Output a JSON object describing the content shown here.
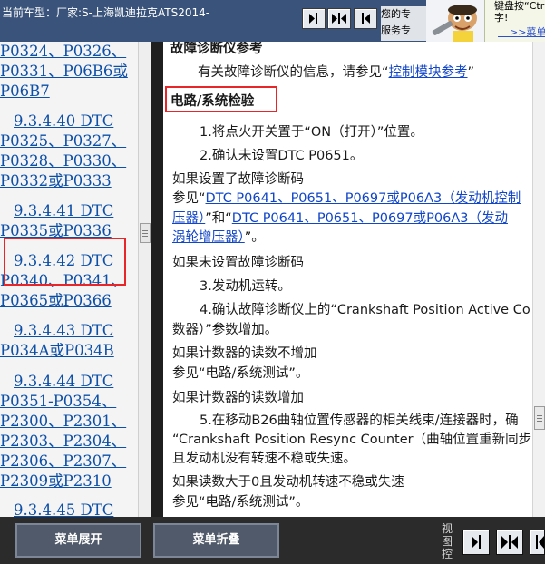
{
  "topbar": {
    "vehicle_text": "当前车型：厂家:S-上海凯迪拉克ATS2014-",
    "nav_buttons": [
      "show-left-panel",
      "show-both-panels",
      "show-right-panel"
    ],
    "expert_line1": "您的专",
    "expert_line2": "服务专",
    "tip_line1": "键盘按“Ctrl",
    "tip_line2": "字!",
    "tip_link": ">>菜单"
  },
  "toc": {
    "items": [
      {
        "lines": [
          "P0324、P0326、",
          "P0331、P06B6或",
          "P06B7"
        ]
      },
      {
        "lines": [
          "9.3.4.40 DTC",
          "P0325、P0327、",
          "P0328、P0330、",
          "P0332或P0333"
        ]
      },
      {
        "lines": [
          "9.3.4.41 DTC",
          "P0335或P0336"
        ],
        "selected": true
      },
      {
        "lines": [
          "9.3.4.42 DTC",
          "P0340、P0341、",
          "P0365或P0366"
        ]
      },
      {
        "lines": [
          "9.3.4.43 DTC",
          "P034A或P034B"
        ]
      },
      {
        "lines": [
          "9.3.4.44 DTC",
          "P0351-P0354、",
          "P2300、P2301、",
          "P2303、P2304、",
          "P2306、P2307、",
          "P2309或P2310"
        ]
      },
      {
        "lines": [
          "9.3.4.45 DTC"
        ]
      }
    ]
  },
  "content": {
    "top_heading": "故障诊断仪参考",
    "ref_prefix": "有关故障诊断仪的信息，请参见“",
    "ref_link": "控制模块参考",
    "ref_suffix": "”",
    "section_heading": "电路/系统检验",
    "step1": "1.将点火开关置于“ON（打开）”位置。",
    "step2": "2.确认未设置DTC P0651。",
    "cond1": "如果设置了故障诊断码",
    "see_prefix": "参见“",
    "link1": "DTC P0641、P0651、P0697或P06A3（发动机控制",
    "link1b": "压器）",
    "and_text": "”和“",
    "link2": "DTC P0641、P0651、P0697或P06A3（发动",
    "link2b": "涡轮增压器）",
    "end_quote": "”。",
    "cond2": "如果未设置故障诊断码",
    "step3": "3.发动机运转。",
    "step4": "4.确认故障诊断仪上的“Crankshaft Position Active Co",
    "step4b": "数器）”参数增加。",
    "cond3": "如果计数器的读数不增加",
    "see_test1": "参见“电路/系统测试”。",
    "cond4": "如果计数器的读数增加",
    "step5": "5.在移动B26曲轴位置传感器的相关线束/连接器时，确",
    "step5b": "“Crankshaft Position Resync Counter（曲轴位置重新同步",
    "step5c": "且发动机没有转速不稳或失速。",
    "cond5": "如果读数大于0且发动机转速不稳或失速",
    "see_test2": "参见“电路/系统测试”。"
  },
  "bottombar": {
    "expand_label": "菜单展开",
    "collapse_label": "菜单折叠",
    "view_label": [
      "视",
      "图",
      "控"
    ]
  },
  "colors": {
    "topbar_bg": "#39537a",
    "link": "#1246c8",
    "toc_link": "#0c4fa8",
    "highlight": "#e8262a",
    "bottombar_bg": "#2b2b2b"
  }
}
